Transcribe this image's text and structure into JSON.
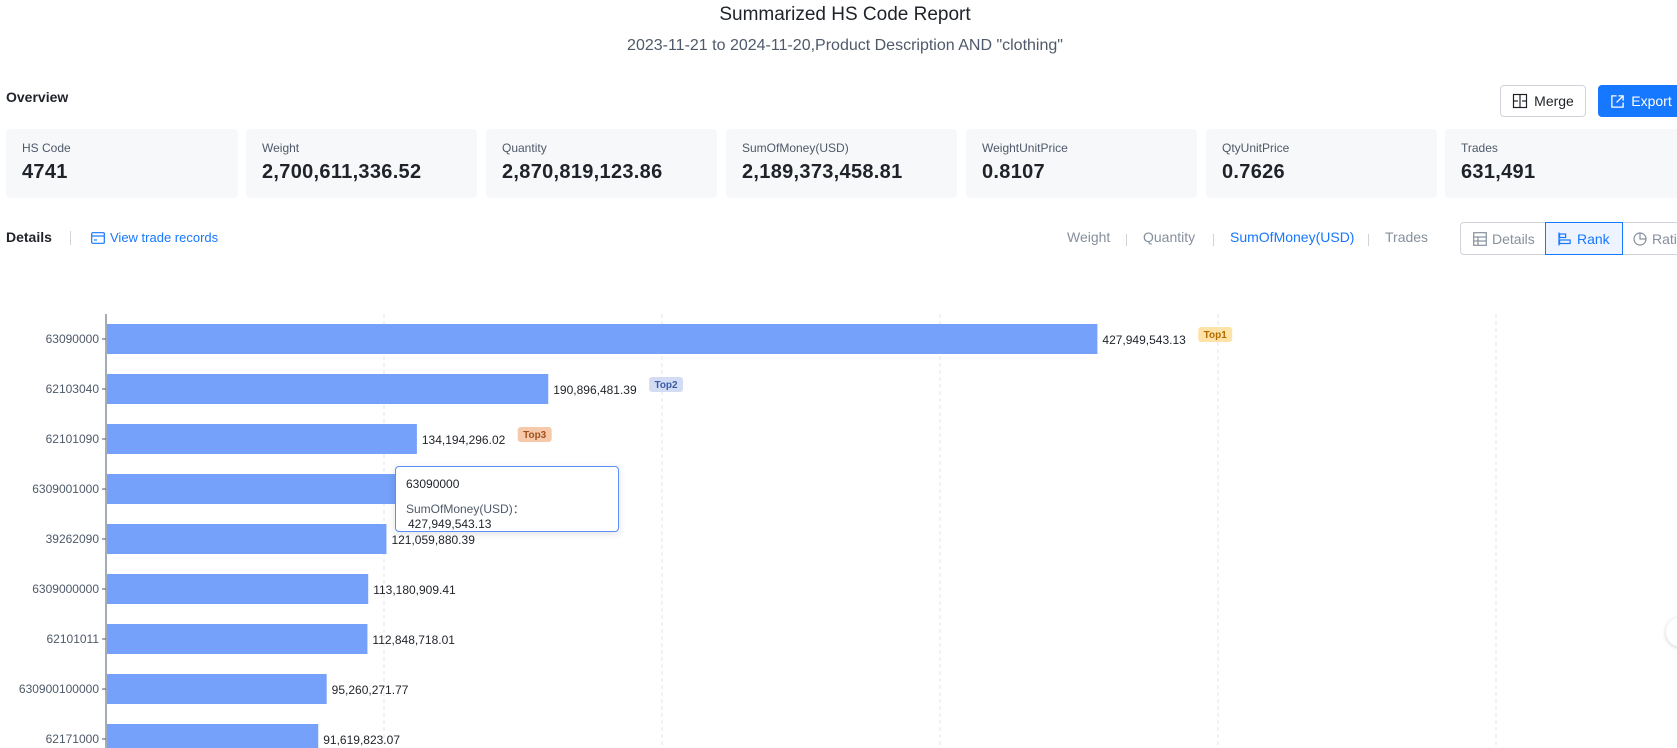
{
  "header": {
    "title": "Summarized HS Code Report",
    "subtitle": "2023-11-21 to 2024-11-20,Product Description AND \"clothing\""
  },
  "overview": {
    "title": "Overview",
    "merge_label": "Merge",
    "export_label": "Export",
    "cards": [
      {
        "label": "HS Code",
        "value": "4741"
      },
      {
        "label": "Weight",
        "value": "2,700,611,336.52"
      },
      {
        "label": "Quantity",
        "value": "2,870,819,123.86"
      },
      {
        "label": "SumOfMoney(USD)",
        "value": "2,189,373,458.81"
      },
      {
        "label": "WeightUnitPrice",
        "value": "0.8107"
      },
      {
        "label": "QtyUnitPrice",
        "value": "0.7626"
      },
      {
        "label": "Trades",
        "value": "631,491"
      }
    ]
  },
  "details": {
    "title": "Details",
    "view_records": "View trade records",
    "metric_tabs": [
      "Weight",
      "Quantity",
      "SumOfMoney(USD)",
      "Trades"
    ],
    "active_metric": "SumOfMoney(USD)",
    "view_modes": [
      "Details",
      "Rank",
      "Ratio"
    ],
    "active_view": "Rank"
  },
  "tooltip": {
    "title": "63090000",
    "label": "SumOfMoney(USD)：",
    "value": "427,949,543.13"
  },
  "colors": {
    "accent": "#1677ff",
    "bar": "#75a1fb",
    "top1_bg": "#fde3a7",
    "top1_fg": "#b26a00",
    "top2_bg": "#d3dcf3",
    "top2_fg": "#3a5ba8",
    "top3_bg": "#f5c9a9",
    "top3_fg": "#a3501f"
  },
  "chart_data": {
    "type": "bar",
    "orientation": "horizontal",
    "categories": [
      "63090000",
      "62103040",
      "62101090",
      "6309001000",
      "39262090",
      "6309000000",
      "62101011",
      "630900100000",
      "62171000"
    ],
    "values": [
      427949543.13,
      190896481.39,
      134194296.02,
      128000000,
      121059880.39,
      113180909.41,
      112848718.01,
      95260271.77,
      91619823.07
    ],
    "value_labels": [
      "427,949,543.13",
      "190,896,481.39",
      "134,194,296.02",
      "",
      "121,059,880.39",
      "113,180,909.41",
      "112,848,718.01",
      "95,260,271.77",
      "91,619,823.07"
    ],
    "badges": [
      "Top1",
      "Top2",
      "Top3"
    ],
    "series": [
      {
        "name": "SumOfMoney(USD)",
        "values": [
          427949543.13,
          190896481.39,
          134194296.02,
          128000000,
          121059880.39,
          113180909.41,
          112848718.01,
          95260271.77,
          91619823.07
        ]
      }
    ],
    "xlim": [
      0,
      600000000
    ],
    "grid": true,
    "legend": "none"
  }
}
